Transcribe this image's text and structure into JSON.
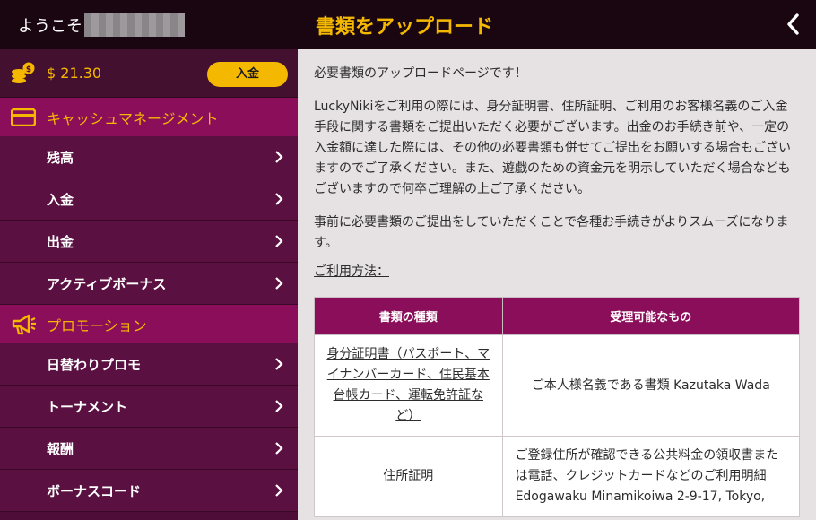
{
  "sidebar": {
    "welcome": "ようこそ",
    "balance": "$ 21.30",
    "deposit_button": "入金",
    "sections": [
      {
        "label": "キャッシュマネージメント",
        "items": [
          "残高",
          "入金",
          "出金",
          "アクティブボーナス"
        ]
      },
      {
        "label": "プロモーション",
        "items": [
          "日替わりプロモ",
          "トーナメント",
          "報酬",
          "ボーナスコード"
        ]
      }
    ]
  },
  "header": {
    "title": "書類をアップロード"
  },
  "content": {
    "intro": "必要書類のアップロードページです！",
    "para1": "LuckyNikiをご利用の際には、身分証明書、住所証明、ご利用のお客様名義のご入金手段に関する書類をご提出いただく必要がございます。出金のお手続き前や、一定の入金額に達した際には、その他の必要書類も併せてご提出をお願いする場合もございますのでご了承ください。また、遊戯のための資金元を明示していただく場合などもございますので何卒ご理解の上ご了承ください。",
    "para2": "事前に必要書類のご提出をしていただくことで各種お手続きがよりスムーズになります。",
    "usage_link": "ご利用方法：",
    "table": {
      "headers": [
        "書類の種類",
        "受理可能なもの"
      ],
      "rows": [
        [
          "身分証明書（パスポート、マイナンバーカード、住民基本台帳カード、運転免許証など）",
          "ご本人様名義である書類 Kazutaka Wada"
        ],
        [
          "住所証明",
          "ご登録住所が確認できる公共料金の領収書または電話、クレジットカードなどのご利用明細 Edogawaku Minamikoiwa 2-9-17, Tokyo,"
        ]
      ]
    }
  },
  "colors": {
    "accent": "#f5b800",
    "section_bg": "#8b0e5a",
    "sidebar_bg": "#5a1040",
    "topbar_bg": "#1a0610"
  }
}
